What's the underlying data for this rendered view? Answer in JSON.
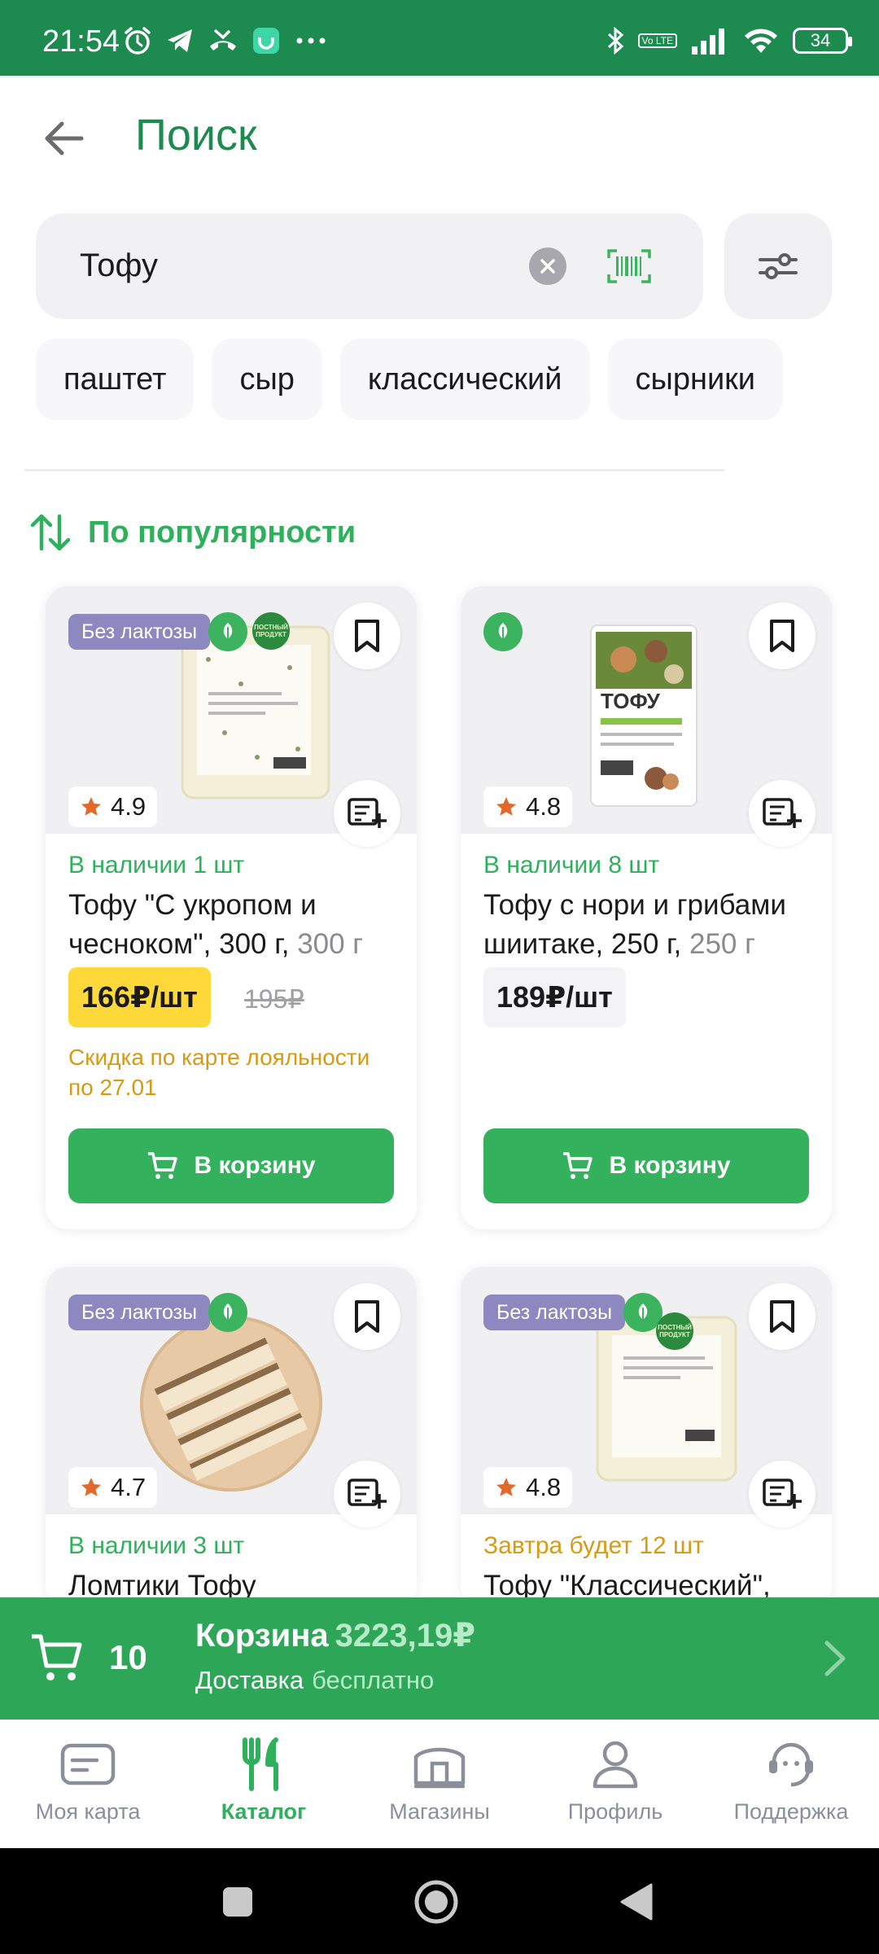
{
  "status_bar": {
    "time": "21:54",
    "battery": "34",
    "volte": "Vo LTE",
    "icons_left": [
      "alarm-icon",
      "telegram-icon",
      "missed-call-icon",
      "app-notification-icon",
      "more-dots-icon"
    ],
    "icons_right": [
      "bluetooth-icon",
      "volte-icon",
      "signal-icon",
      "wifi-icon",
      "battery-icon"
    ]
  },
  "header": {
    "title": "Поиск"
  },
  "search": {
    "value": "Тофу",
    "placeholder": ""
  },
  "chips": [
    "паштет",
    "сыр",
    "классический",
    "сырники"
  ],
  "sort": {
    "label": "По популярности"
  },
  "products": [
    {
      "badge": "Без лактозы",
      "lent_badge": "ПОСТНЫЙ ПРОДУКТ",
      "rating": "4.9",
      "stock": "В наличии 1 шт",
      "name": "Тофу \"С укропом и чесноком\", 300 г,",
      "weight": "300 г",
      "price": "166₽/шт",
      "old_price": "195₽",
      "promo": "Скидка по карте лояльности по 27.01",
      "cart_label": "В корзину",
      "image_colors": [
        "#f0f0f2",
        "#f3efd9",
        "#e4dfbf"
      ]
    },
    {
      "badge": "",
      "rating": "4.8",
      "stock": "В наличии 8 шт",
      "name": "Тофу с нори и грибами шиитаке, 250 г,",
      "weight": "250 г",
      "price": "189₽/шт",
      "cart_label": "В корзину",
      "image_colors": [
        "#f0f0f2",
        "#ffffff",
        "#6a8a3a"
      ]
    },
    {
      "badge": "Без лактозы",
      "rating": "4.7",
      "stock": "В наличии 3 шт",
      "name": "Ломтики Тофу",
      "image_colors": [
        "#f0f0f2",
        "#e7c9a6",
        "#8a6a48"
      ]
    },
    {
      "badge": "Без лактозы",
      "lent_badge": "ПОСТНЫЙ ПРОДУКТ",
      "rating": "4.8",
      "stock": "Завтра будет 12 шт",
      "name": "Тофу \"Классический\",",
      "image_colors": [
        "#f0f0f2",
        "#f3efd9",
        "#e4dfbf"
      ]
    }
  ],
  "cart": {
    "count": "10",
    "title": "Корзина",
    "sum": "3223,19₽",
    "delivery_label": "Доставка",
    "delivery_value": "бесплатно"
  },
  "bottom_nav": [
    {
      "label": "Моя карта",
      "icon": "card-icon",
      "active": false
    },
    {
      "label": "Каталог",
      "icon": "fork-knife-icon",
      "active": true
    },
    {
      "label": "Магазины",
      "icon": "store-icon",
      "active": false
    },
    {
      "label": "Профиль",
      "icon": "profile-icon",
      "active": false
    },
    {
      "label": "Поддержка",
      "icon": "support-icon",
      "active": false
    }
  ],
  "colors": {
    "brand_green": "#1d8a4f",
    "accent_green": "#2eb05c",
    "button_green": "#34b15d",
    "price_yellow": "#ffd83a",
    "promo_orange": "#d79a12",
    "lactose_badge": "#8d88bf"
  }
}
